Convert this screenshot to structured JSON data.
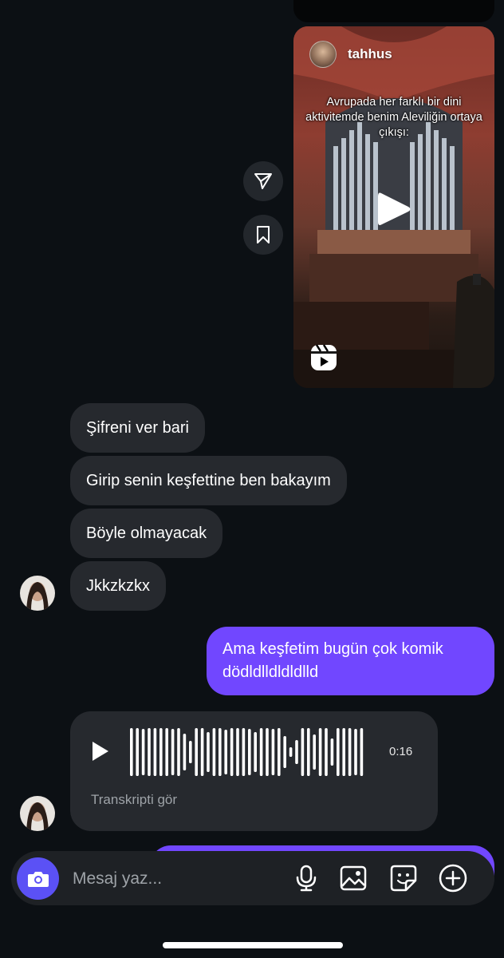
{
  "reel": {
    "username": "tahhus",
    "caption": "Avrupada her farklı bir dini aktivitemde benim Aleviliğin ortaya çıkışı:"
  },
  "received_messages": [
    {
      "text": "Şifreni ver bari"
    },
    {
      "text": "Girip senin keşfettine ben bakayım"
    },
    {
      "text": "Böyle olmayacak"
    },
    {
      "text": "Jkkzkzkx"
    }
  ],
  "sent_message": {
    "text": "Ama keşfetim bugün çok komik dödldlldldldlld"
  },
  "voice_message": {
    "duration": "0:16",
    "transcript_label": "Transkripti gör"
  },
  "composer": {
    "placeholder": "Mesaj yaz..."
  },
  "colors": {
    "background": "#0c1014",
    "received_bubble": "#26292e",
    "sent_bubble": "#7147ff",
    "camera_button": "#5b51f5"
  }
}
